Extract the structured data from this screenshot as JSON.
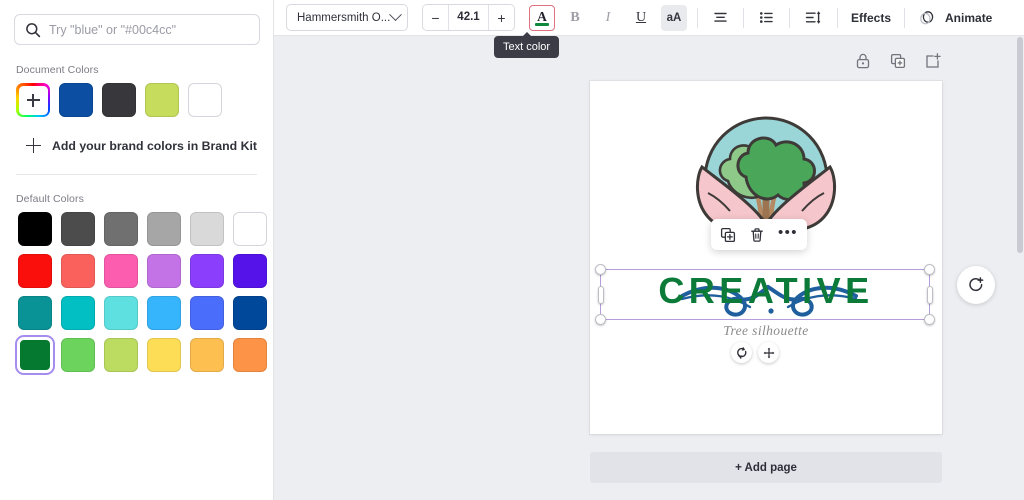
{
  "sidebar": {
    "search": {
      "placeholder": "Try \"blue\" or \"#00c4cc\"",
      "value": "",
      "icon": "search-icon"
    },
    "document_colors": {
      "label": "Document Colors",
      "add_swatch_label": "+",
      "swatches": [
        {
          "name": "custom-color-picker",
          "color": "rainbow"
        },
        {
          "name": "doc-color-blue",
          "color": "#0b4ea2"
        },
        {
          "name": "doc-color-dark",
          "color": "#38383c"
        },
        {
          "name": "doc-color-lime",
          "color": "#c5dc5c"
        },
        {
          "name": "doc-color-white",
          "color": "#ffffff"
        }
      ]
    },
    "brand_kit": {
      "label": "Add your brand colors in Brand Kit",
      "icon": "plus-icon"
    },
    "default_colors": {
      "label": "Default Colors",
      "rows": [
        [
          {
            "name": "black",
            "color": "#000000",
            "selected": false
          },
          {
            "name": "dark-gray",
            "color": "#4c4c4c",
            "selected": false
          },
          {
            "name": "gray",
            "color": "#707070",
            "selected": false
          },
          {
            "name": "mid-gray",
            "color": "#a6a6a6",
            "selected": false
          },
          {
            "name": "light-gray",
            "color": "#d9d9d9",
            "selected": false
          },
          {
            "name": "white",
            "color": "#ffffff",
            "selected": false
          }
        ],
        [
          {
            "name": "red",
            "color": "#fa0f0c",
            "selected": false
          },
          {
            "name": "salmon",
            "color": "#fb615c",
            "selected": false
          },
          {
            "name": "pink",
            "color": "#fc5daf",
            "selected": false
          },
          {
            "name": "orchid",
            "color": "#c373e5",
            "selected": false
          },
          {
            "name": "purple",
            "color": "#8b3ffd",
            "selected": false
          },
          {
            "name": "violet",
            "color": "#5513ea",
            "selected": false
          }
        ],
        [
          {
            "name": "teal",
            "color": "#0a9396",
            "selected": false
          },
          {
            "name": "cyan",
            "color": "#01bfc3",
            "selected": false
          },
          {
            "name": "aqua",
            "color": "#5fe0e0",
            "selected": false
          },
          {
            "name": "sky-blue",
            "color": "#36b4fc",
            "selected": false
          },
          {
            "name": "royal-blue",
            "color": "#4a6dfb",
            "selected": false
          },
          {
            "name": "navy",
            "color": "#00489a",
            "selected": false
          }
        ],
        [
          {
            "name": "dark-green",
            "color": "#04792f",
            "selected": true
          },
          {
            "name": "green",
            "color": "#6cd45d",
            "selected": false
          },
          {
            "name": "yellow-green",
            "color": "#bbdc60",
            "selected": false
          },
          {
            "name": "yellow",
            "color": "#fddd56",
            "selected": false
          },
          {
            "name": "amber",
            "color": "#fdbf50",
            "selected": false
          },
          {
            "name": "orange",
            "color": "#fd9346",
            "selected": false
          }
        ]
      ]
    }
  },
  "toolbar": {
    "font_name": "Hammersmith O...",
    "font_size": "42.1",
    "decrease_label": "−",
    "increase_label": "+",
    "text_color_glyph": "A",
    "text_color_value": "#0f8a3c",
    "bold_label": "B",
    "italic_label": "I",
    "underline_label": "U",
    "case_label": "aA",
    "align_icon": "align-center-icon",
    "list_icon": "bullet-list-icon",
    "spacing_icon": "line-spacing-icon",
    "effects_label": "Effects",
    "animate_label": "Animate",
    "animate_icon": "animate-icon",
    "tooltip": "Text color"
  },
  "canvas": {
    "header_icons": [
      {
        "name": "lock-icon"
      },
      {
        "name": "duplicate-page-icon"
      },
      {
        "name": "add-page-icon"
      }
    ],
    "design": {
      "title": "CREATIVE",
      "subtitle": "Tree silhouette",
      "title_color": "#0c7a39",
      "subtitle_color": "#8a8a8a",
      "circle_color": "#9ad5d7",
      "tree_color": "#4aa75a",
      "petal_color": "#f5c6cb",
      "flourish_color": "#1f5f9e"
    },
    "context_menu": {
      "duplicate_icon": "duplicate-icon",
      "delete_icon": "trash-icon",
      "more_label": "•••"
    },
    "element_controls": [
      {
        "name": "rotate-handle-icon"
      },
      {
        "name": "move-handle-icon"
      }
    ],
    "regenerate_icon": "regenerate-icon",
    "add_page_label": "+ Add page"
  }
}
